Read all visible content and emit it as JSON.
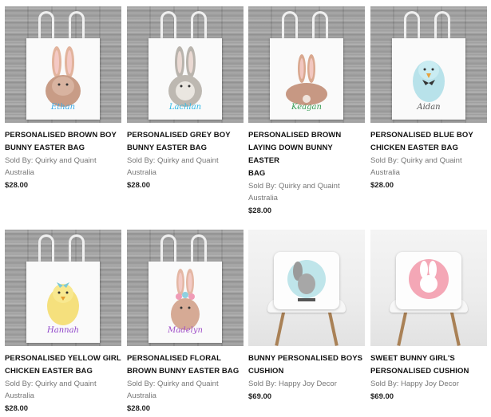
{
  "products": [
    {
      "title_line1": "PERSONALISED BROWN BOY",
      "title_line2": "BUNNY EASTER BAG",
      "title_line3": "",
      "seller": "Sold By: Quirky and Quaint",
      "seller_location": "Australia",
      "price": "$28.00",
      "script_name": "Ethan",
      "script_color": "#38a9e8",
      "animal": "brown-bunny-icon"
    },
    {
      "title_line1": "PERSONALISED GREY BOY",
      "title_line2": "BUNNY EASTER BAG",
      "title_line3": "",
      "seller": "Sold By: Quirky and Quaint",
      "seller_location": "Australia",
      "price": "$28.00",
      "script_name": "Lachlan",
      "script_color": "#2fb8e6",
      "animal": "grey-bunny-icon"
    },
    {
      "title_line1": "PERSONALISED BROWN",
      "title_line2": "LAYING DOWN BUNNY EASTER",
      "title_line3": "BAG",
      "seller": "Sold By: Quirky and Quaint",
      "seller_location": "Australia",
      "price": "$28.00",
      "script_name": "Keagan",
      "script_color": "#3a9e57",
      "animal": "laying-bunny-icon"
    },
    {
      "title_line1": "PERSONALISED BLUE BOY",
      "title_line2": "CHICKEN EASTER BAG",
      "title_line3": "",
      "seller": "Sold By: Quirky and Quaint",
      "seller_location": "Australia",
      "price": "$28.00",
      "script_name": "Aidan",
      "script_color": "#555555",
      "animal": "blue-chicken-icon"
    },
    {
      "title_line1": "PERSONALISED YELLOW GIRL",
      "title_line2": "CHICKEN EASTER BAG",
      "title_line3": "",
      "seller": "Sold By: Quirky and Quaint",
      "seller_location": "Australia",
      "price": "$28.00",
      "script_name": "Hannah",
      "script_color": "#8e44c9",
      "animal": "yellow-chicken-icon"
    },
    {
      "title_line1": "PERSONALISED FLORAL",
      "title_line2": "BROWN BUNNY EASTER BAG",
      "title_line3": "",
      "seller": "Sold By: Quirky and Quaint",
      "seller_location": "Australia",
      "price": "$28.00",
      "script_name": "Madelyn",
      "script_color": "#a04fc8",
      "animal": "floral-bunny-icon"
    },
    {
      "title_line1": "BUNNY PERSONALISED BOYS",
      "title_line2": "CUSHION",
      "title_line3": "",
      "seller": "Sold By: Happy Joy Decor",
      "seller_location": "",
      "price": "$69.00",
      "script_name": "",
      "script_color": "#4bb3c4",
      "animal": "bunny-cushion-icon"
    },
    {
      "title_line1": "SWEET BUNNY GIRL'S",
      "title_line2": "PERSONALISED CUSHION",
      "title_line3": "",
      "seller": "Sold By: Happy Joy Decor",
      "seller_location": "",
      "price": "$69.00",
      "script_name": "",
      "script_color": "#f08fa8",
      "animal": "pink-bunny-cushion-icon"
    }
  ]
}
